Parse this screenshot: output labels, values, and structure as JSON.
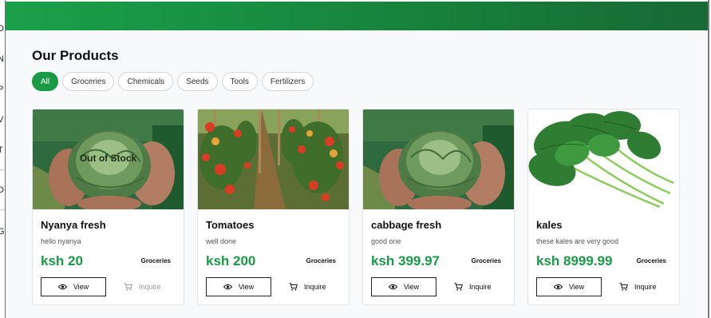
{
  "left_strip": {
    "letters": [
      "D",
      "N",
      "P",
      "V",
      "T",
      "D",
      "G"
    ]
  },
  "section": {
    "title": "Our Products"
  },
  "filters": [
    {
      "label": "All",
      "active": true
    },
    {
      "label": "Groceries",
      "active": false
    },
    {
      "label": "Chemicals",
      "active": false
    },
    {
      "label": "Seeds",
      "active": false
    },
    {
      "label": "Tools",
      "active": false
    },
    {
      "label": "Fertilizers",
      "active": false
    }
  ],
  "products": [
    {
      "name": "Nyanya fresh",
      "description": "hello nyanya",
      "price": "ksh 20",
      "category": "Groceries",
      "badge": "Out of Stock",
      "view_label": "View",
      "inquire_label": "Inquire",
      "inquire_enabled": false,
      "image": "cabbage-in-hands"
    },
    {
      "name": "Tomatoes",
      "description": "well done",
      "price": "ksh 200",
      "category": "Groceries",
      "badge": "",
      "view_label": "View",
      "inquire_label": "Inquire",
      "inquire_enabled": true,
      "image": "tomato-plants"
    },
    {
      "name": "cabbage fresh",
      "description": "good one",
      "price": "ksh 399.97",
      "category": "Groceries",
      "badge": "",
      "view_label": "View",
      "inquire_label": "Inquire",
      "inquire_enabled": true,
      "image": "cabbage-in-hands"
    },
    {
      "name": "kales",
      "description": "these kales are very good",
      "price": "ksh 8999.99",
      "category": "Groceries",
      "badge": "",
      "view_label": "View",
      "inquire_label": "Inquire",
      "inquire_enabled": true,
      "image": "kale-bunch"
    }
  ],
  "colors": {
    "accent": "#1a9a45",
    "header_start": "#1aa04a",
    "header_end": "#176a33"
  }
}
